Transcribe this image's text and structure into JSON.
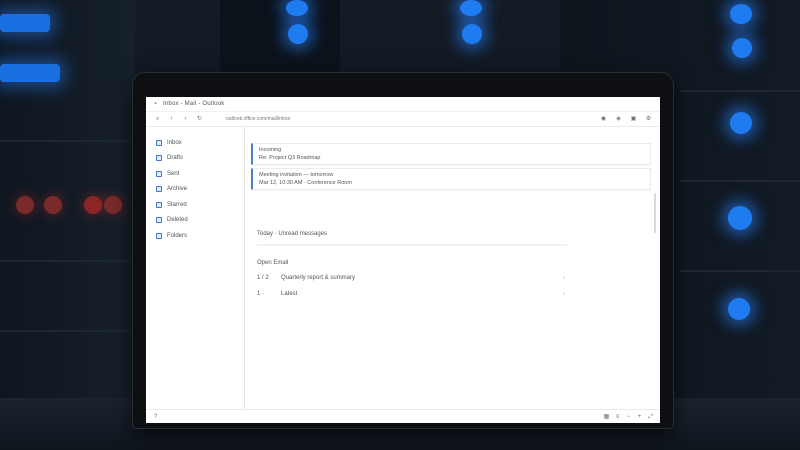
{
  "window": {
    "title": "Inbox - Mail - Outlook"
  },
  "toolbar": {
    "address": "outlook.office.com/mail/inbox"
  },
  "sidebar": {
    "items": [
      {
        "label": "Inbox"
      },
      {
        "label": "Drafts"
      },
      {
        "label": "Sent"
      },
      {
        "label": "Archive"
      },
      {
        "label": "Starred"
      },
      {
        "label": "Deleted"
      },
      {
        "label": "Folders"
      }
    ]
  },
  "messages": [
    {
      "line1": "Incoming",
      "line2": "Re: Project Q3 Roadmap"
    },
    {
      "line1": "Meeting invitation — tomorrow",
      "line2": "Mar 12, 10:30 AM · Conference Room"
    }
  ],
  "section": {
    "title": "Today · Unread messages"
  },
  "list": {
    "header": "Open  Email",
    "rows": [
      {
        "num": "1 / 2",
        "value": "Quarterly report & summary"
      },
      {
        "num": "1 ·",
        "value": "Latest"
      }
    ]
  },
  "colors": {
    "accent": "#4b82c7",
    "screen_bg": "#ffffff",
    "server_light": "#1f7cf0"
  }
}
